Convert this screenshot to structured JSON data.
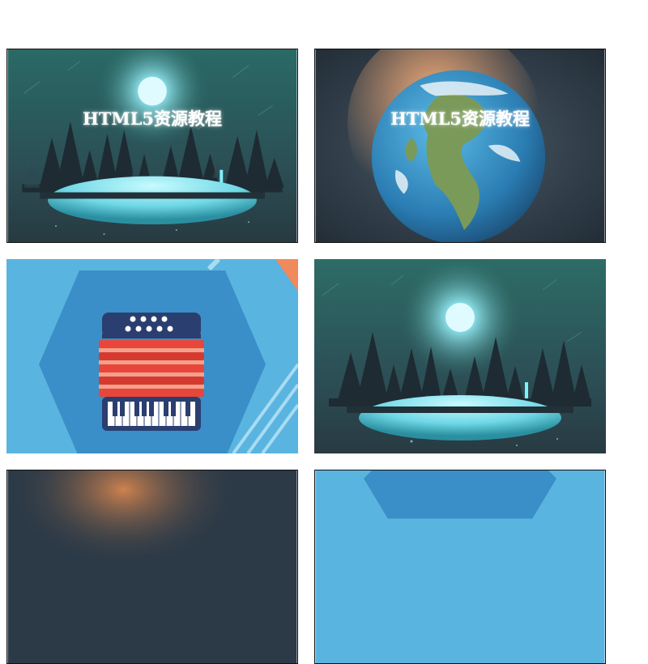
{
  "gallery": {
    "tiles": [
      {
        "caption": "HTML5资源教程",
        "scene": "moonlit-forest-lake",
        "colors": {
          "sky": "#2d6b6a",
          "moon": "#c9f3ff",
          "lake": "#7fe3f0"
        }
      },
      {
        "caption": "HTML5资源教程",
        "scene": "earth-globe",
        "colors": {
          "bg": "#2c3a47",
          "glow": "#e08a4f",
          "ocean": "#2f8ac0",
          "land": "#6f9a5a"
        }
      },
      {
        "caption": "",
        "scene": "accordion-hexagon",
        "colors": {
          "bg": "#5ab4e0",
          "hex": "#3a8fc8",
          "body": "#e0463a",
          "accent": "#f08a5d"
        }
      },
      {
        "caption": "",
        "scene": "moonlit-forest-lake",
        "colors": {
          "sky": "#2d6b6a",
          "moon": "#c9f3ff",
          "lake": "#7fe3f0"
        }
      },
      {
        "caption": "",
        "scene": "earth-globe-partial",
        "colors": {
          "bg": "#2c3a47",
          "glow": "#e08a4f"
        }
      },
      {
        "caption": "",
        "scene": "accordion-hexagon-partial",
        "colors": {
          "bg": "#5ab4e0",
          "hex": "#3a8fc8"
        }
      }
    ]
  }
}
